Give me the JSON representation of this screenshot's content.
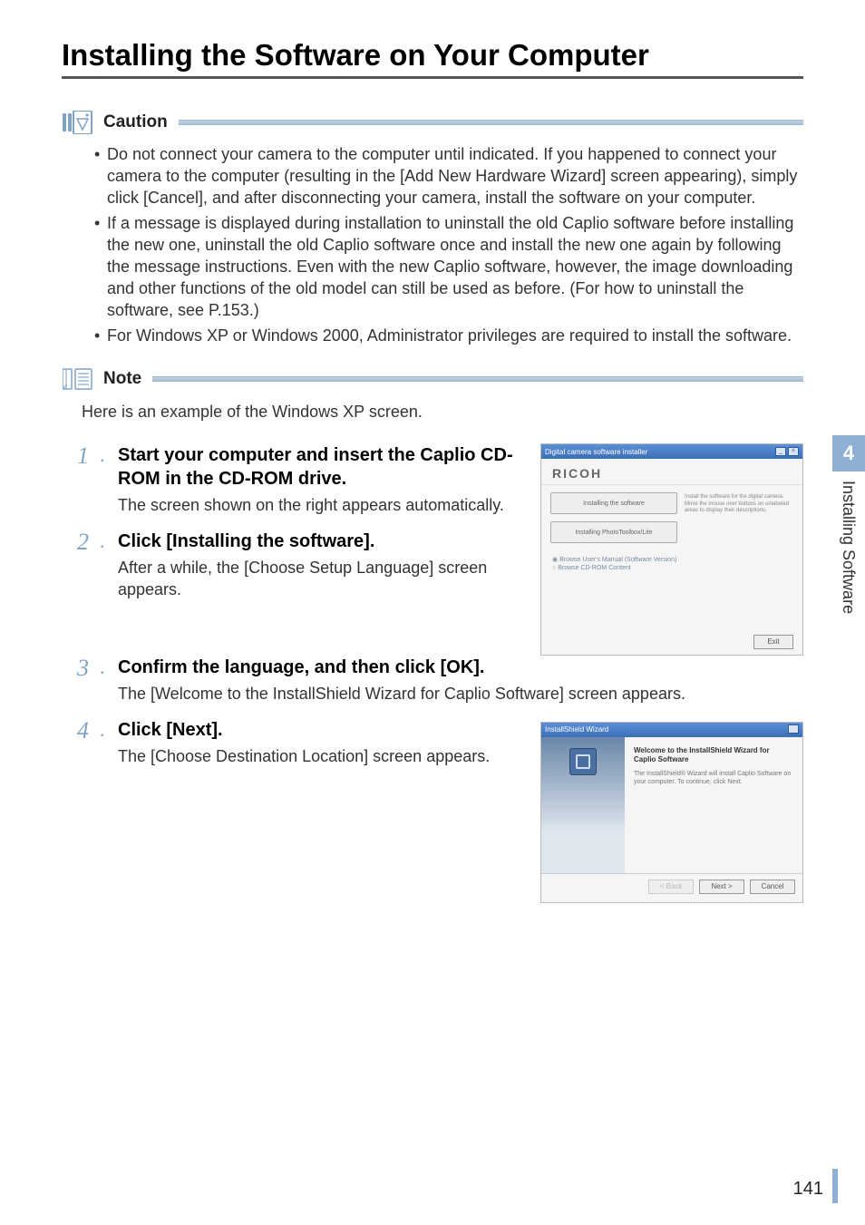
{
  "heading": "Installing the Software on Your Computer",
  "caution": {
    "label": "Caution",
    "items": [
      "Do not connect your camera to the computer until indicated. If you happened to connect your camera to the computer (resulting in the [Add New Hardware Wizard] screen appearing), simply click [Cancel], and after disconnecting your camera, install the software on your computer.",
      "If a message is displayed during installation to uninstall the old Caplio software before installing the new one, uninstall the old Caplio software once and install the new one again by following the message instructions. Even with the new Caplio software, however, the image downloading and other functions of the old model can still be used as before. (For how to uninstall the software, see P.153.)",
      "For Windows XP or Windows 2000, Administrator privileges are required to install the software."
    ]
  },
  "note": {
    "label": "Note",
    "intro": "Here is an example of the Windows XP screen."
  },
  "steps": [
    {
      "num": "1",
      "dot": ".",
      "title": "Start your computer and insert the Caplio CD-ROM in the CD-ROM drive.",
      "desc": "The screen shown on the right appears automatically."
    },
    {
      "num": "2",
      "dot": ".",
      "title": "Click [Installing the software].",
      "desc": "After a while, the [Choose Setup Language] screen appears."
    },
    {
      "num": "3",
      "dot": ".",
      "title": "Confirm the language, and then click [OK].",
      "desc": "The [Welcome to the InstallShield Wizard for Caplio Software] screen appears."
    },
    {
      "num": "4",
      "dot": ".",
      "title": "Click [Next].",
      "desc": "The [Choose Destination Location] screen appears."
    }
  ],
  "shot1": {
    "titlebar": "Digital camera software installer",
    "logo": "RICOH",
    "opt1": "Installing the software",
    "opt2": "Installing PhotoToolbox/Lite",
    "side": "Install the software for the digital camera. Move the mouse over buttons on unlabeled areas to display their descriptions.",
    "radio1": "Browse User's Manual (Software Version)",
    "radio2": "Browse CD-ROM Content",
    "exit": "Exit"
  },
  "shot2": {
    "titlebar": "InstallShield Wizard",
    "welcome_title": "Welcome to the InstallShield Wizard for Caplio Software",
    "welcome_desc": "The InstallShield® Wizard will install Caplio Software on your computer. To continue, click Next.",
    "back": "< Back",
    "next": "Next >",
    "cancel": "Cancel"
  },
  "sidebar": {
    "chapter": "4",
    "section": "Installing Software"
  },
  "page_number": "141"
}
